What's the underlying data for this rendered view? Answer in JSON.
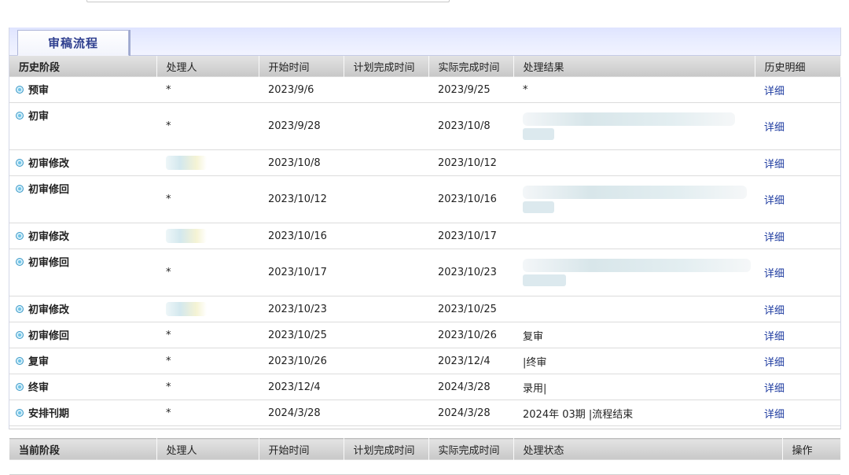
{
  "tab": {
    "label": "审稿流程"
  },
  "history": {
    "headers": [
      "历史阶段",
      "处理人",
      "开始时间",
      "计划完成时间",
      "实际完成时间",
      "处理结果",
      "历史明细"
    ],
    "rows": [
      {
        "stage": "预审",
        "handler": "*",
        "start": "2023/9/6",
        "planned": "",
        "actual": "2023/9/25",
        "result": "*",
        "detail": "详细"
      },
      {
        "stage": "初审",
        "handler": "*",
        "start": "2023/9/28",
        "planned": "",
        "actual": "2023/10/8",
        "result": "",
        "detail": "详细"
      },
      {
        "stage": "初审修改",
        "handler": "",
        "start": "2023/10/8",
        "planned": "",
        "actual": "2023/10/12",
        "result": "",
        "detail": "详细"
      },
      {
        "stage": "初审修回",
        "handler": "*",
        "start": "2023/10/12",
        "planned": "",
        "actual": "2023/10/16",
        "result": "",
        "detail": "详细"
      },
      {
        "stage": "初审修改",
        "handler": "",
        "start": "2023/10/16",
        "planned": "",
        "actual": "2023/10/17",
        "result": "",
        "detail": "详细"
      },
      {
        "stage": "初审修回",
        "handler": "*",
        "start": "2023/10/17",
        "planned": "",
        "actual": "2023/10/23",
        "result": "",
        "detail": "详细"
      },
      {
        "stage": "初审修改",
        "handler": "",
        "start": "2023/10/23",
        "planned": "",
        "actual": "2023/10/25",
        "result": "",
        "detail": "详细"
      },
      {
        "stage": "初审修回",
        "handler": "*",
        "start": "2023/10/25",
        "planned": "",
        "actual": "2023/10/26",
        "result": "复审",
        "detail": "详细"
      },
      {
        "stage": "复审",
        "handler": "*",
        "start": "2023/10/26",
        "planned": "",
        "actual": "2023/12/4",
        "result": "|终审",
        "detail": "详细"
      },
      {
        "stage": "终审",
        "handler": "*",
        "start": "2023/12/4",
        "planned": "",
        "actual": "2024/3/28",
        "result": "录用|",
        "detail": "详细"
      },
      {
        "stage": "安排刊期",
        "handler": "*",
        "start": "2024/3/28",
        "planned": "",
        "actual": "2024/3/28",
        "result": "2024年 03期 |流程结束",
        "detail": "详细"
      }
    ]
  },
  "current": {
    "headers": [
      "当前阶段",
      "处理人",
      "开始时间",
      "计划完成时间",
      "实际完成时间",
      "处理状态",
      "操作"
    ]
  }
}
